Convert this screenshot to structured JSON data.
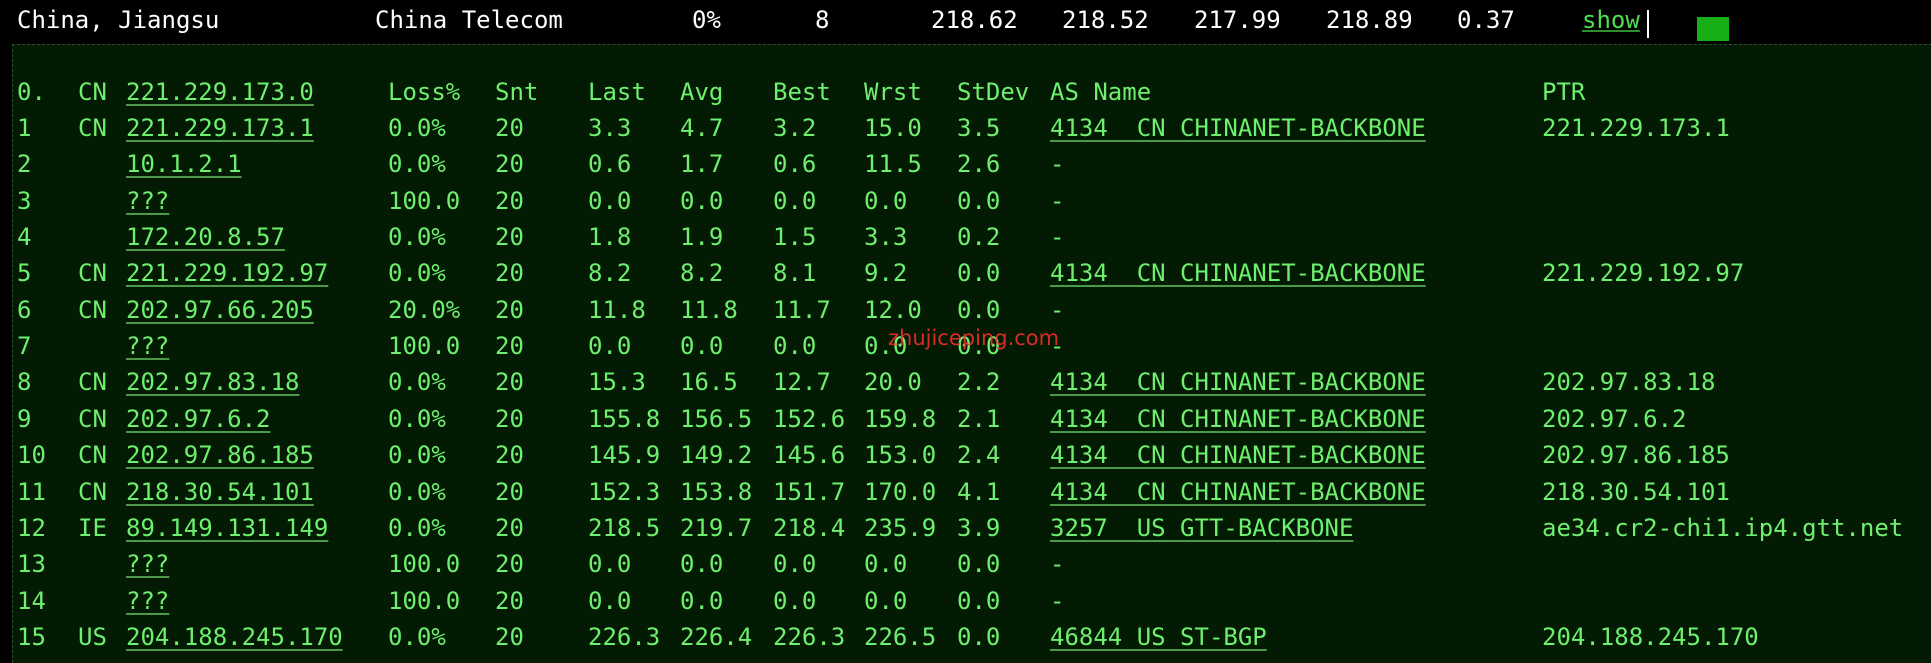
{
  "summary": {
    "location": "China, Jiangsu",
    "isp": "China Telecom",
    "loss": "0%",
    "hops": "8",
    "v1": "218.62",
    "v2": "218.52",
    "v3": "217.99",
    "v4": "218.89",
    "v5": "0.37",
    "show_label": "show"
  },
  "table": {
    "header": {
      "hop": "0.",
      "cc": "CN",
      "host": "221.229.173.0",
      "loss": "Loss%",
      "snt": "Snt",
      "last": "Last",
      "avg": "Avg",
      "best": "Best",
      "wrst": "Wrst",
      "stdev": "StDev",
      "asname": "AS Name",
      "ptr": "PTR"
    },
    "rows": [
      {
        "hop": "1",
        "cc": "CN",
        "host": "221.229.173.1",
        "loss": "0.0%",
        "snt": "20",
        "last": "3.3",
        "avg": "4.7",
        "best": "3.2",
        "wrst": "15.0",
        "stdev": "3.5",
        "asname": "4134  CN CHINANET-BACKBONE",
        "ptr": "221.229.173.1"
      },
      {
        "hop": "2",
        "cc": "",
        "host": "10.1.2.1",
        "loss": "0.0%",
        "snt": "20",
        "last": "0.6",
        "avg": "1.7",
        "best": "0.6",
        "wrst": "11.5",
        "stdev": "2.6",
        "asname": "-",
        "ptr": ""
      },
      {
        "hop": "3",
        "cc": "",
        "host": "???",
        "loss": "100.0",
        "snt": "20",
        "last": "0.0",
        "avg": "0.0",
        "best": "0.0",
        "wrst": "0.0",
        "stdev": "0.0",
        "asname": "-",
        "ptr": ""
      },
      {
        "hop": "4",
        "cc": "",
        "host": "172.20.8.57",
        "loss": "0.0%",
        "snt": "20",
        "last": "1.8",
        "avg": "1.9",
        "best": "1.5",
        "wrst": "3.3",
        "stdev": "0.2",
        "asname": "-",
        "ptr": ""
      },
      {
        "hop": "5",
        "cc": "CN",
        "host": "221.229.192.97",
        "loss": "0.0%",
        "snt": "20",
        "last": "8.2",
        "avg": "8.2",
        "best": "8.1",
        "wrst": "9.2",
        "stdev": "0.0",
        "asname": "4134  CN CHINANET-BACKBONE",
        "ptr": "221.229.192.97"
      },
      {
        "hop": "6",
        "cc": "CN",
        "host": "202.97.66.205",
        "loss": "20.0%",
        "snt": "20",
        "last": "11.8",
        "avg": "11.8",
        "best": "11.7",
        "wrst": "12.0",
        "stdev": "0.0",
        "asname": "-",
        "ptr": ""
      },
      {
        "hop": "7",
        "cc": "",
        "host": "???",
        "loss": "100.0",
        "snt": "20",
        "last": "0.0",
        "avg": "0.0",
        "best": "0.0",
        "wrst": "0.0",
        "stdev": "0.0",
        "asname": "-",
        "ptr": ""
      },
      {
        "hop": "8",
        "cc": "CN",
        "host": "202.97.83.18",
        "loss": "0.0%",
        "snt": "20",
        "last": "15.3",
        "avg": "16.5",
        "best": "12.7",
        "wrst": "20.0",
        "stdev": "2.2",
        "asname": "4134  CN CHINANET-BACKBONE",
        "ptr": "202.97.83.18"
      },
      {
        "hop": "9",
        "cc": "CN",
        "host": "202.97.6.2",
        "loss": "0.0%",
        "snt": "20",
        "last": "155.8",
        "avg": "156.5",
        "best": "152.6",
        "wrst": "159.8",
        "stdev": "2.1",
        "asname": "4134  CN CHINANET-BACKBONE",
        "ptr": "202.97.6.2"
      },
      {
        "hop": "10",
        "cc": "CN",
        "host": "202.97.86.185",
        "loss": "0.0%",
        "snt": "20",
        "last": "145.9",
        "avg": "149.2",
        "best": "145.6",
        "wrst": "153.0",
        "stdev": "2.4",
        "asname": "4134  CN CHINANET-BACKBONE",
        "ptr": "202.97.86.185"
      },
      {
        "hop": "11",
        "cc": "CN",
        "host": "218.30.54.101",
        "loss": "0.0%",
        "snt": "20",
        "last": "152.3",
        "avg": "153.8",
        "best": "151.7",
        "wrst": "170.0",
        "stdev": "4.1",
        "asname": "4134  CN CHINANET-BACKBONE",
        "ptr": "218.30.54.101"
      },
      {
        "hop": "12",
        "cc": "IE",
        "host": "89.149.131.149",
        "loss": "0.0%",
        "snt": "20",
        "last": "218.5",
        "avg": "219.7",
        "best": "218.4",
        "wrst": "235.9",
        "stdev": "3.9",
        "asname": "3257  US GTT-BACKBONE",
        "ptr": "ae34.cr2-chi1.ip4.gtt.net"
      },
      {
        "hop": "13",
        "cc": "",
        "host": "???",
        "loss": "100.0",
        "snt": "20",
        "last": "0.0",
        "avg": "0.0",
        "best": "0.0",
        "wrst": "0.0",
        "stdev": "0.0",
        "asname": "-",
        "ptr": ""
      },
      {
        "hop": "14",
        "cc": "",
        "host": "???",
        "loss": "100.0",
        "snt": "20",
        "last": "0.0",
        "avg": "0.0",
        "best": "0.0",
        "wrst": "0.0",
        "stdev": "0.0",
        "asname": "-",
        "ptr": ""
      },
      {
        "hop": "15",
        "cc": "US",
        "host": "204.188.245.170",
        "loss": "0.0%",
        "snt": "20",
        "last": "226.3",
        "avg": "226.4",
        "best": "226.3",
        "wrst": "226.5",
        "stdev": "0.0",
        "asname": "46844 US ST-BGP",
        "ptr": "204.188.245.170"
      }
    ]
  },
  "watermark": "zhujiceping.com"
}
